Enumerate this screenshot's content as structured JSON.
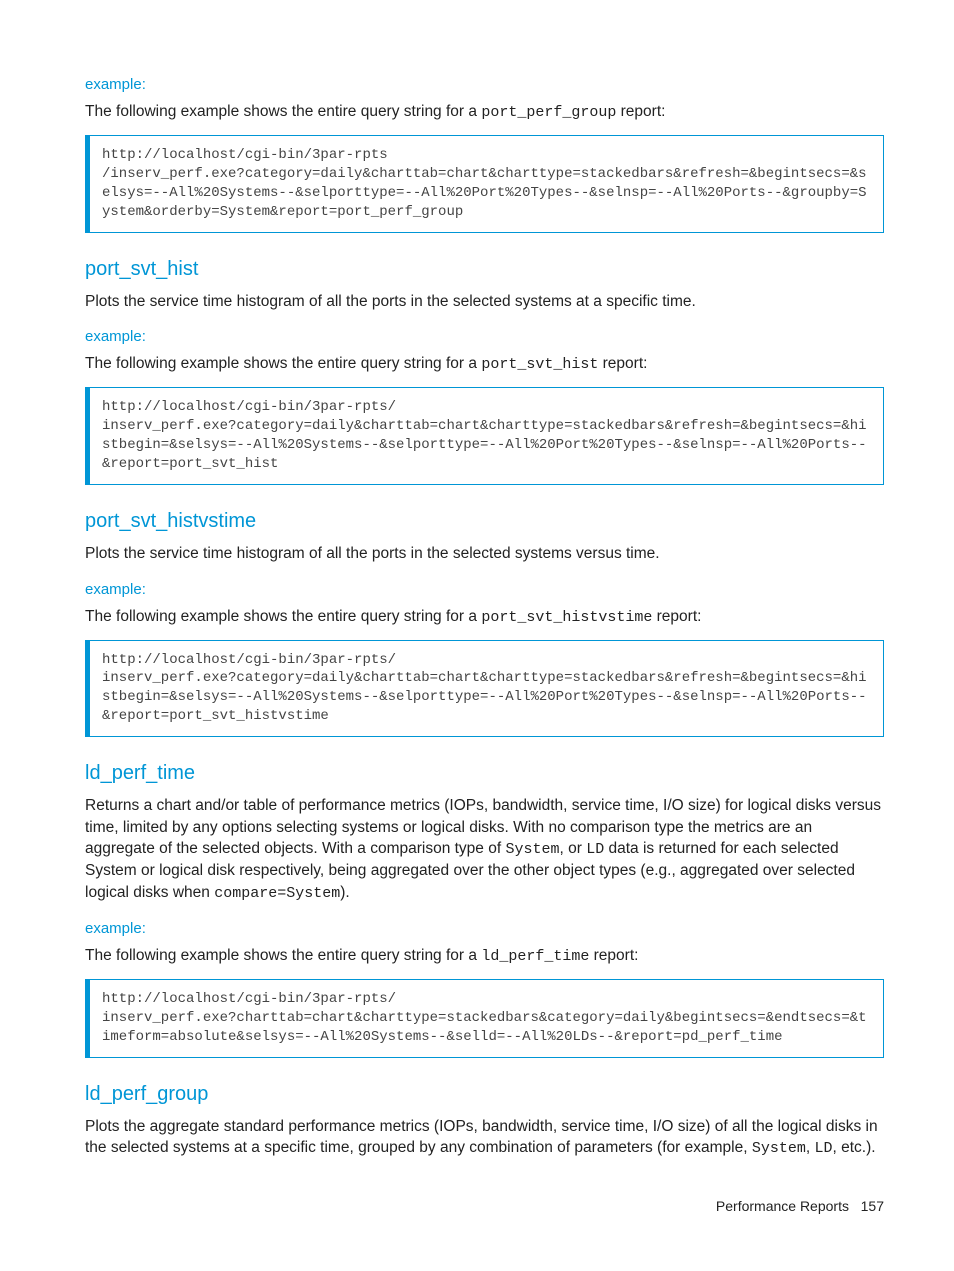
{
  "sections": [
    {
      "example_label": "example:",
      "example_intro_pre": "The following example shows the entire query string for a ",
      "example_intro_code": "port_perf_group",
      "example_intro_post": " report:",
      "code": "http://localhost/cgi-bin/3par-rpts\n/inserv_perf.exe?category=daily&charttab=chart&charttype=stackedbars&refresh=&begintsecs=&selsys=--All%20Systems--&selporttype=--All%20Port%20Types--&selnsp=--All%20Ports--&groupby=System&orderby=System&report=port_perf_group"
    },
    {
      "heading": "port_svt_hist",
      "description": "Plots the service time histogram of all the ports in the selected systems at a specific time.",
      "example_label": "example:",
      "example_intro_pre": "The following example shows the entire query string for a ",
      "example_intro_code": "port_svt_hist",
      "example_intro_post": " report:",
      "code": "http://localhost/cgi-bin/3par-rpts/\ninserv_perf.exe?category=daily&charttab=chart&charttype=stackedbars&refresh=&begintsecs=&histbegin=&selsys=--All%20Systems--&selporttype=--All%20Port%20Types--&selnsp=--All%20Ports--&report=port_svt_hist"
    },
    {
      "heading": "port_svt_histvstime",
      "description": "Plots the service time histogram of all the ports in the selected systems versus time.",
      "example_label": "example:",
      "example_intro_pre": "The following example shows the entire query string for a ",
      "example_intro_code": "port_svt_histvstime",
      "example_intro_post": " report:",
      "code": "http://localhost/cgi-bin/3par-rpts/\ninserv_perf.exe?category=daily&charttab=chart&charttype=stackedbars&refresh=&begintsecs=&histbegin=&selsys=--All%20Systems--&selporttype=--All%20Port%20Types--&selnsp=--All%20Ports--&report=port_svt_histvstime"
    },
    {
      "heading": "ld_perf_time",
      "description_parts": {
        "p1": "Returns a chart and/or table of performance metrics (IOPs, bandwidth, service time, I/O size) for logical disks versus time, limited by any options selecting systems or logical disks. With no comparison type the metrics are an aggregate of the selected objects. With a comparison type of ",
        "c1": "System",
        "p2": ", or ",
        "c2": "LD",
        "p3": "  data is returned for each selected System or logical disk respectively, being aggregated over the other object types (e.g., aggregated over selected logical disks when ",
        "c3": "compare=System",
        "p4": ")."
      },
      "example_label": "example:",
      "example_intro_pre": "The following example shows the entire query string for a ",
      "example_intro_code": "ld_perf_time",
      "example_intro_post": " report:",
      "code": "http://localhost/cgi-bin/3par-rpts/\ninserv_perf.exe?charttab=chart&charttype=stackedbars&category=daily&begintsecs=&endtsecs=&timeform=absolute&selsys=--All%20Systems--&selld=--All%20LDs--&report=pd_perf_time"
    },
    {
      "heading": "ld_perf_group",
      "description_parts": {
        "p1": "Plots the aggregate standard performance metrics (IOPs, bandwidth, service time, I/O size) of all the logical disks in the selected systems at a specific time, grouped by any combination of parameters (for example, ",
        "c1": "System",
        "p2": ", ",
        "c2": "LD",
        "p3": ", etc.)."
      }
    }
  ],
  "footer": {
    "section": "Performance Reports",
    "page": "157"
  }
}
